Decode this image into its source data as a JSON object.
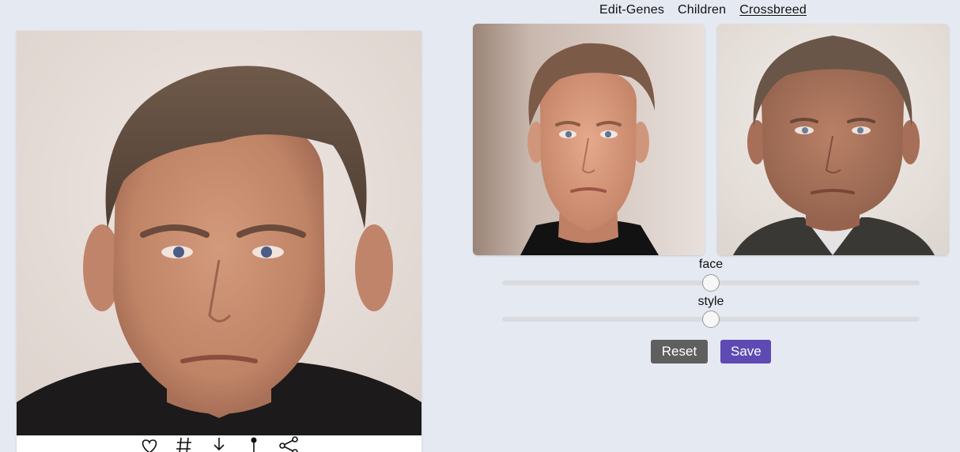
{
  "tabs": [
    {
      "label": "Edit-Genes",
      "active": false
    },
    {
      "label": "Children",
      "active": false
    },
    {
      "label": "Crossbreed",
      "active": true
    }
  ],
  "main_image": {
    "icon": "generated-face-portrait"
  },
  "actions": [
    {
      "icon": "heart-icon"
    },
    {
      "icon": "hash-icon"
    },
    {
      "icon": "download-icon"
    },
    {
      "icon": "pin-icon"
    },
    {
      "icon": "share-icon"
    }
  ],
  "parents": [
    {
      "icon": "parent-face-1"
    },
    {
      "icon": "parent-face-2"
    }
  ],
  "sliders": [
    {
      "label": "face",
      "value": 0.5
    },
    {
      "label": "style",
      "value": 0.5
    }
  ],
  "buttons": {
    "reset_label": "Reset",
    "save_label": "Save"
  },
  "colors": {
    "background": "#e5e9f1",
    "reset_button": "#5f5f60",
    "save_button": "#5d4bb3",
    "slider_track": "#dadbde"
  }
}
